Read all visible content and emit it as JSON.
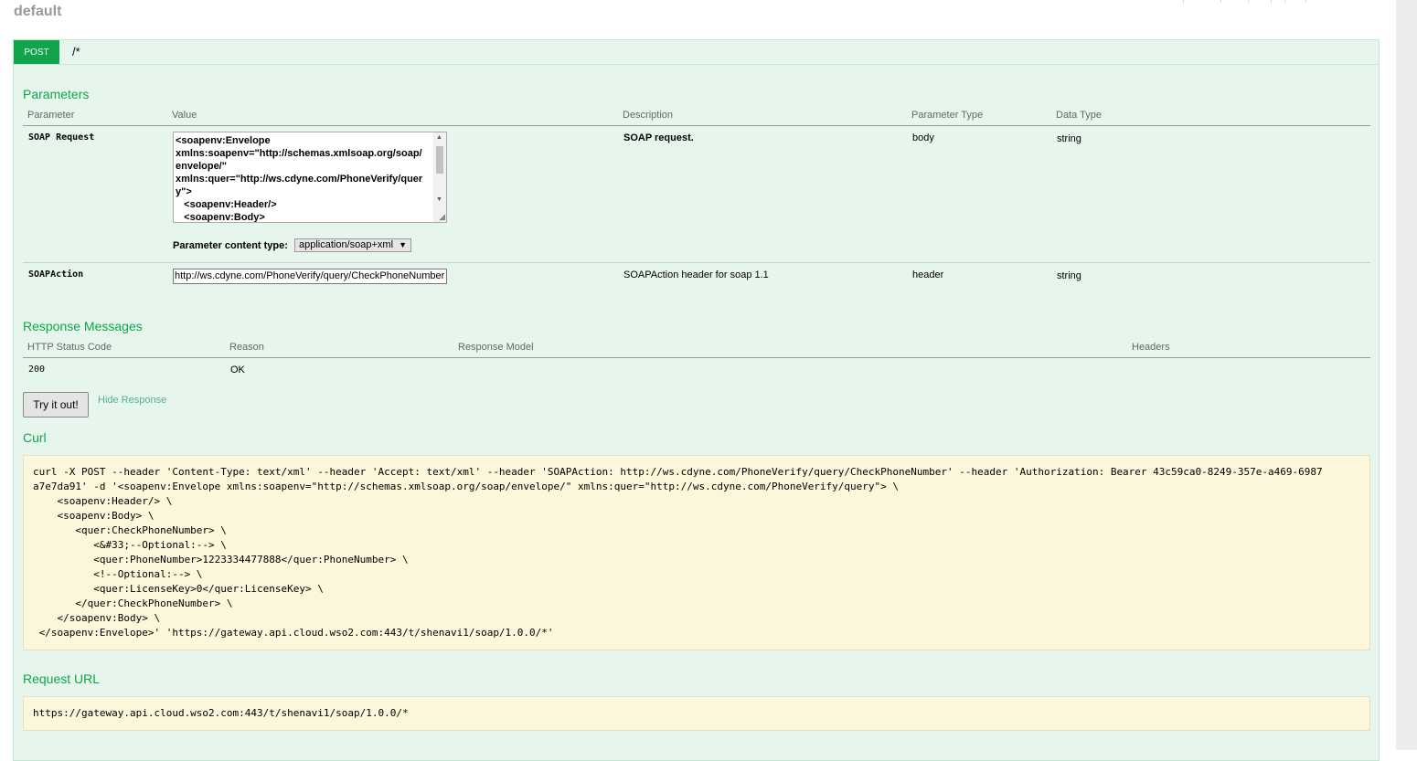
{
  "resource": {
    "title": "default"
  },
  "operation": {
    "method": "POST",
    "path": "/*"
  },
  "parameters": {
    "title": "Parameters",
    "headers": {
      "parameter": "Parameter",
      "value": "Value",
      "description": "Description",
      "param_type": "Parameter Type",
      "data_type": "Data Type"
    },
    "rows": [
      {
        "name": "SOAP Request",
        "value_text": "<soapenv:Envelope\nxmlns:soapenv=\"http://schemas.xmlsoap.org/soap/\nenvelope/\"\nxmlns:quer=\"http://ws.cdyne.com/PhoneVerify/quer\ny\">\n   <soapenv:Header/>\n   <soapenv:Body>",
        "content_type_label": "Parameter content type:",
        "content_type_value": "application/soap+xml",
        "description": "SOAP request.",
        "param_type": "body",
        "data_type": "string"
      },
      {
        "name": "SOAPAction",
        "value": "http://ws.cdyne.com/PhoneVerify/query/CheckPhoneNumber",
        "description": "SOAPAction header for soap 1.1",
        "param_type": "header",
        "data_type": "string"
      }
    ]
  },
  "responses": {
    "title": "Response Messages",
    "headers": {
      "status": "HTTP Status Code",
      "reason": "Reason",
      "model": "Response Model",
      "headers": "Headers"
    },
    "rows": [
      {
        "status": "200",
        "reason": "OK"
      }
    ]
  },
  "actions": {
    "try_label": "Try it out!",
    "hide_label": "Hide Response"
  },
  "curl": {
    "title": "Curl",
    "text": "curl -X POST --header 'Content-Type: text/xml' --header 'Accept: text/xml' --header 'SOAPAction: http://ws.cdyne.com/PhoneVerify/query/CheckPhoneNumber' --header 'Authorization: Bearer 43c59ca0-8249-357e-a469-6987\na7e7da91' -d '<soapenv:Envelope xmlns:soapenv=\"http://schemas.xmlsoap.org/soap/envelope/\" xmlns:quer=\"http://ws.cdyne.com/PhoneVerify/query\"> \\\n    <soapenv:Header/> \\\n    <soapenv:Body> \\\n       <quer:CheckPhoneNumber> \\\n          <&#33;--Optional:--> \\\n          <quer:PhoneNumber>1223334477888</quer:PhoneNumber> \\\n          <!--Optional:--> \\\n          <quer:LicenseKey>0</quer:LicenseKey> \\\n       </quer:CheckPhoneNumber> \\\n    </soapenv:Body> \\\n </soapenv:Envelope>' 'https://gateway.api.cloud.wso2.com:443/t/shenavi1/soap/1.0.0/*'"
  },
  "request_url": {
    "title": "Request URL",
    "url": "https://gateway.api.cloud.wso2.com:443/t/shenavi1/soap/1.0.0/*"
  }
}
